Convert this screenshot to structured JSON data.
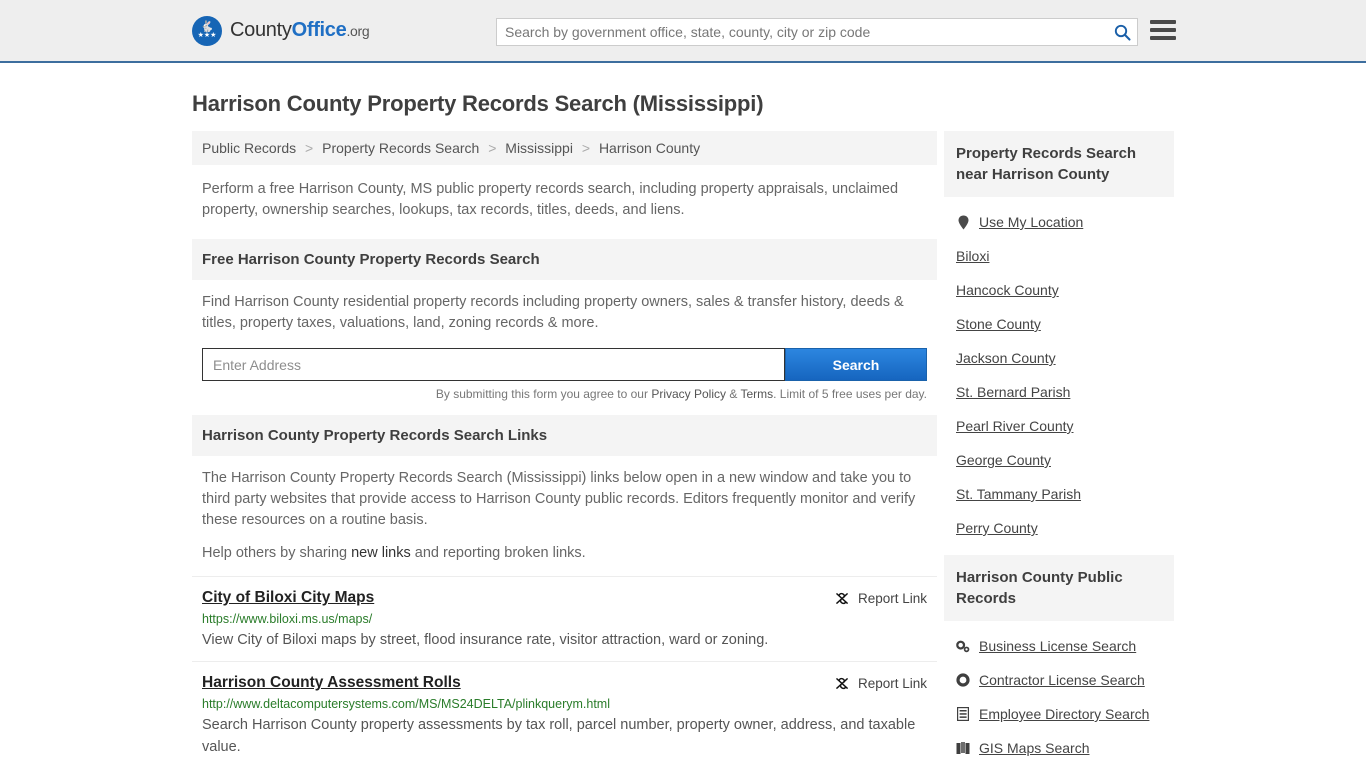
{
  "header": {
    "brand": {
      "part1": "County",
      "part2": "Office",
      "part3": ".org",
      "seal_icon": "eagle-seal-icon"
    },
    "search_placeholder": "Search by government office, state, county, city or zip code",
    "search_value": "",
    "search_icon": "search-icon",
    "menu_icon": "hamburger-menu-icon"
  },
  "page": {
    "title": "Harrison County Property Records Search (Mississippi)",
    "breadcrumb": [
      "Public Records",
      "Property Records Search",
      "Mississippi",
      "Harrison County"
    ],
    "breadcrumb_separator": ">",
    "intro": "Perform a free Harrison County, MS public property records search, including property appraisals, unclaimed property, ownership searches, lookups, tax records, titles, deeds, and liens."
  },
  "free_search": {
    "heading": "Free Harrison County Property Records Search",
    "body": "Find Harrison County residential property records including property owners, sales & transfer history, deeds & titles, property taxes, valuations, land, zoning records & more.",
    "input_placeholder": "Enter Address",
    "input_value": "",
    "button_label": "Search",
    "note_prefix": "By submitting this form you agree to our ",
    "note_privacy": "Privacy Policy",
    "note_amp": " & ",
    "note_terms": "Terms",
    "note_suffix": ". Limit of 5 free uses per day."
  },
  "links_section": {
    "heading": "Harrison County Property Records Search Links",
    "paragraph": "The Harrison County Property Records Search (Mississippi) links below open in a new window and take you to third party websites that provide access to Harrison County public records. Editors frequently monitor and verify these resources on a routine basis.",
    "help_prefix": "Help others by sharing ",
    "help_link": "new links",
    "help_suffix": " and reporting broken links.",
    "report_label": "Report Link",
    "report_icon": "broken-link-icon",
    "items": [
      {
        "title": "City of Biloxi City Maps",
        "url": "https://www.biloxi.ms.us/maps/",
        "description": "View City of Biloxi maps by street, flood insurance rate, visitor attraction, ward or zoning."
      },
      {
        "title": "Harrison County Assessment Rolls",
        "url": "http://www.deltacomputersystems.com/MS/MS24DELTA/plinkquerym.html",
        "description": "Search Harrison County property assessments by tax roll, parcel number, property owner, address, and taxable value."
      }
    ]
  },
  "sidebar": {
    "nearby": {
      "heading": "Property Records Search near Harrison County",
      "use_my_location": {
        "label": "Use My Location",
        "icon": "map-pin-icon"
      },
      "items": [
        "Biloxi",
        "Hancock County",
        "Stone County",
        "Jackson County",
        "St. Bernard Parish",
        "Pearl River County",
        "George County",
        "St. Tammany Parish",
        "Perry County"
      ]
    },
    "public_records": {
      "heading": "Harrison County Public Records",
      "items": [
        {
          "label": "Business License Search",
          "icon": "cogs-icon"
        },
        {
          "label": "Contractor License Search",
          "icon": "cog-icon"
        },
        {
          "label": "Employee Directory Search",
          "icon": "list-alt-icon"
        },
        {
          "label": "GIS Maps Search",
          "icon": "map-book-icon"
        }
      ]
    }
  },
  "colors": {
    "brand_blue": "#1f6fc4",
    "header_bg": "#eeeeee",
    "header_border": "#3d6e9e",
    "panel_bg": "#f4f4f4",
    "button_blue": "#1665bf",
    "url_green": "#2a7c2a"
  }
}
